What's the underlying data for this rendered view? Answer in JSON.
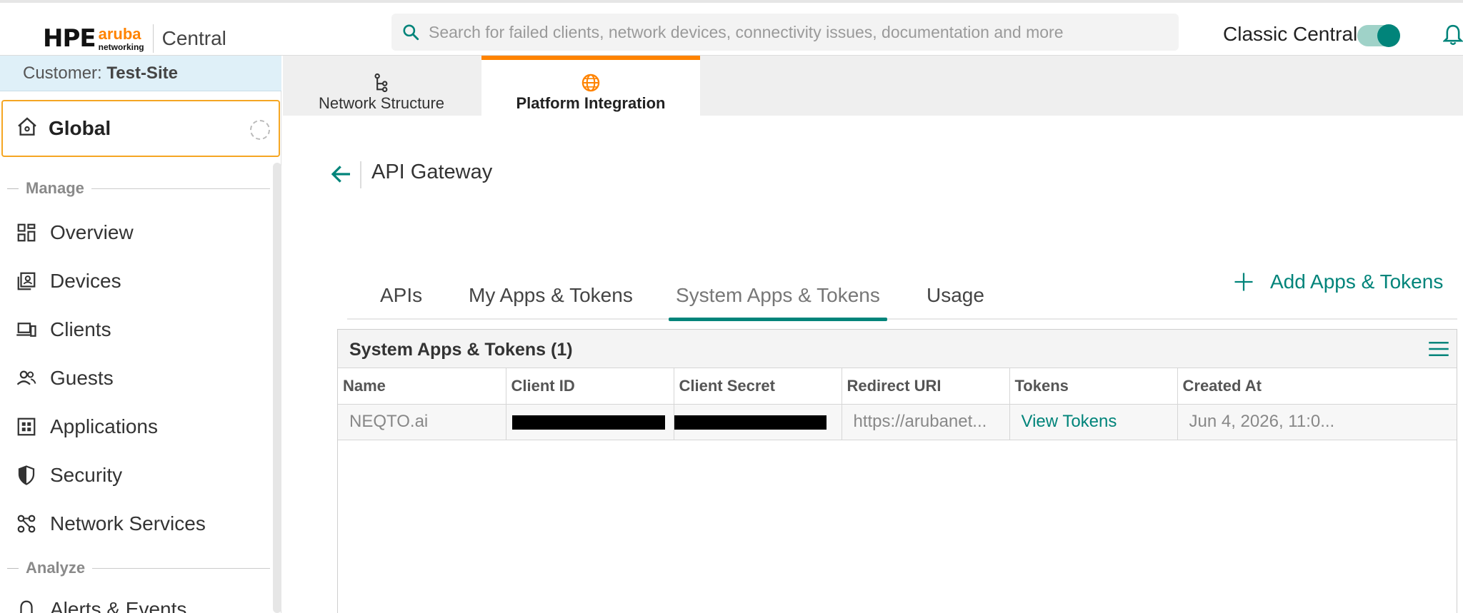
{
  "header": {
    "logo_hpe": "HPE",
    "logo_aruba": "aruba",
    "logo_networking": "networking",
    "product": "Central",
    "search_placeholder": "Search for failed clients, network devices, connectivity issues, documentation and more",
    "classic_central_label": "Classic Central",
    "classic_central_on": true
  },
  "sidebar": {
    "customer_prefix": "Customer:",
    "customer_name": "Test-Site",
    "scope": "Global",
    "sections": [
      {
        "title": "Manage"
      },
      {
        "title": "Analyze"
      }
    ],
    "items": [
      {
        "label": "Overview",
        "icon": "grid-icon"
      },
      {
        "label": "Devices",
        "icon": "devices-icon"
      },
      {
        "label": "Clients",
        "icon": "clients-icon"
      },
      {
        "label": "Guests",
        "icon": "guests-icon"
      },
      {
        "label": "Applications",
        "icon": "applications-icon"
      },
      {
        "label": "Security",
        "icon": "shield-icon"
      },
      {
        "label": "Network Services",
        "icon": "network-services-icon"
      },
      {
        "label": "Alerts & Events",
        "icon": "bell-icon"
      }
    ]
  },
  "main": {
    "tabs": [
      {
        "label": "Network Structure",
        "icon": "network-structure-icon"
      },
      {
        "label": "Platform Integration",
        "icon": "globe-icon",
        "active": true
      }
    ],
    "page_title": "API Gateway",
    "subtabs": [
      {
        "label": "APIs"
      },
      {
        "label": "My Apps & Tokens"
      },
      {
        "label": "System Apps & Tokens",
        "active": true
      },
      {
        "label": "Usage"
      }
    ],
    "add_button": "Add Apps & Tokens",
    "table": {
      "title": "System Apps & Tokens (1)",
      "columns": [
        "Name",
        "Client ID",
        "Client Secret",
        "Redirect URI",
        "Tokens",
        "Created At"
      ],
      "rows": [
        {
          "name": "NEQTO.ai",
          "client_id": "[redacted]",
          "client_secret": "[redacted]",
          "redirect_uri": "https://arubanet...",
          "tokens": "View Tokens",
          "created_at": "Jun 4, 2026, 11:0..."
        }
      ]
    }
  },
  "colors": {
    "accent_teal": "#01847a",
    "accent_orange": "#ff8300",
    "customer_bar": "#dff0f8"
  }
}
